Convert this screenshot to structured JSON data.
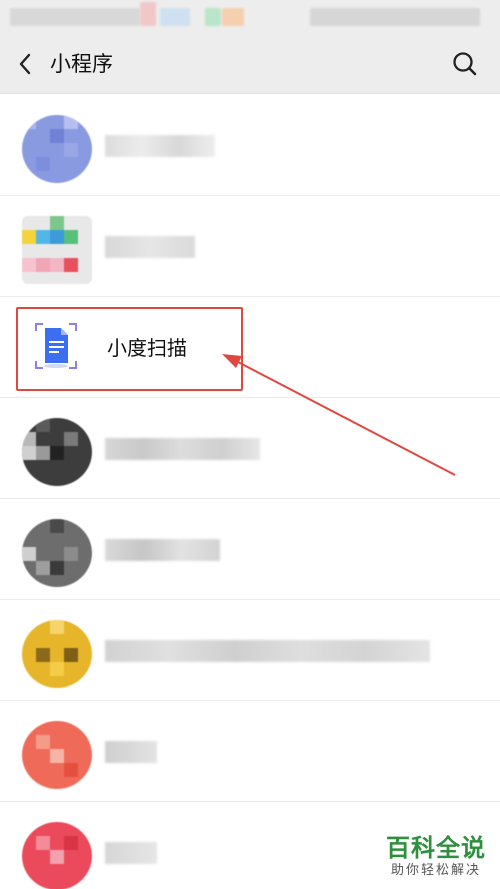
{
  "nav": {
    "title": "小程序",
    "back_icon": "chevron-left-icon",
    "search_icon": "search-icon"
  },
  "list": {
    "highlighted_item": {
      "name": "小度扫描",
      "icon": "document-scan-icon"
    }
  },
  "annotation": {
    "color": "#e0473f"
  },
  "watermark": {
    "title": "百科全说",
    "subtitle": "助你轻松解决",
    "color": "#2f8f3e"
  }
}
